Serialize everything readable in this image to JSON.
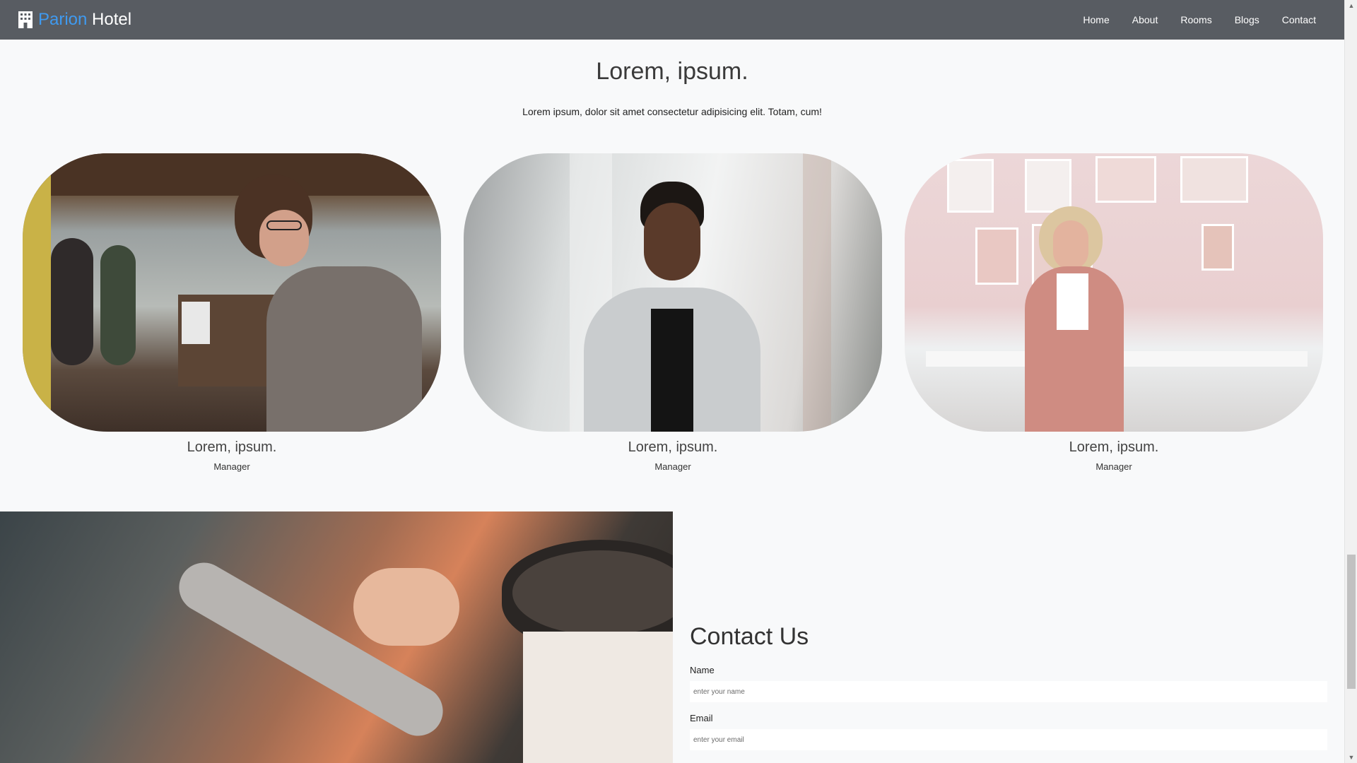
{
  "navbar": {
    "brand_accent": "Parion",
    "brand_name": " Hotel",
    "brand_icon": "building-icon",
    "links": [
      "Home",
      "About",
      "Rooms",
      "Blogs",
      "Contact"
    ]
  },
  "team": {
    "title": "Lorem, ipsum.",
    "subtitle": "Lorem ipsum, dolor sit amet consectetur adipisicing elit. Totam, cum!",
    "members": [
      {
        "name": "Lorem, ipsum.",
        "role": "Manager"
      },
      {
        "name": "Lorem, ipsum.",
        "role": "Manager"
      },
      {
        "name": "Lorem, ipsum.",
        "role": "Manager"
      }
    ]
  },
  "contact": {
    "title": "Contact Us",
    "name_label": "Name",
    "name_placeholder": "enter your name",
    "email_label": "Email",
    "email_placeholder": "enter your email"
  },
  "colors": {
    "navbar": "#585c62",
    "brand_accent": "#3f9af0",
    "page_background": "#f8f9fa"
  }
}
